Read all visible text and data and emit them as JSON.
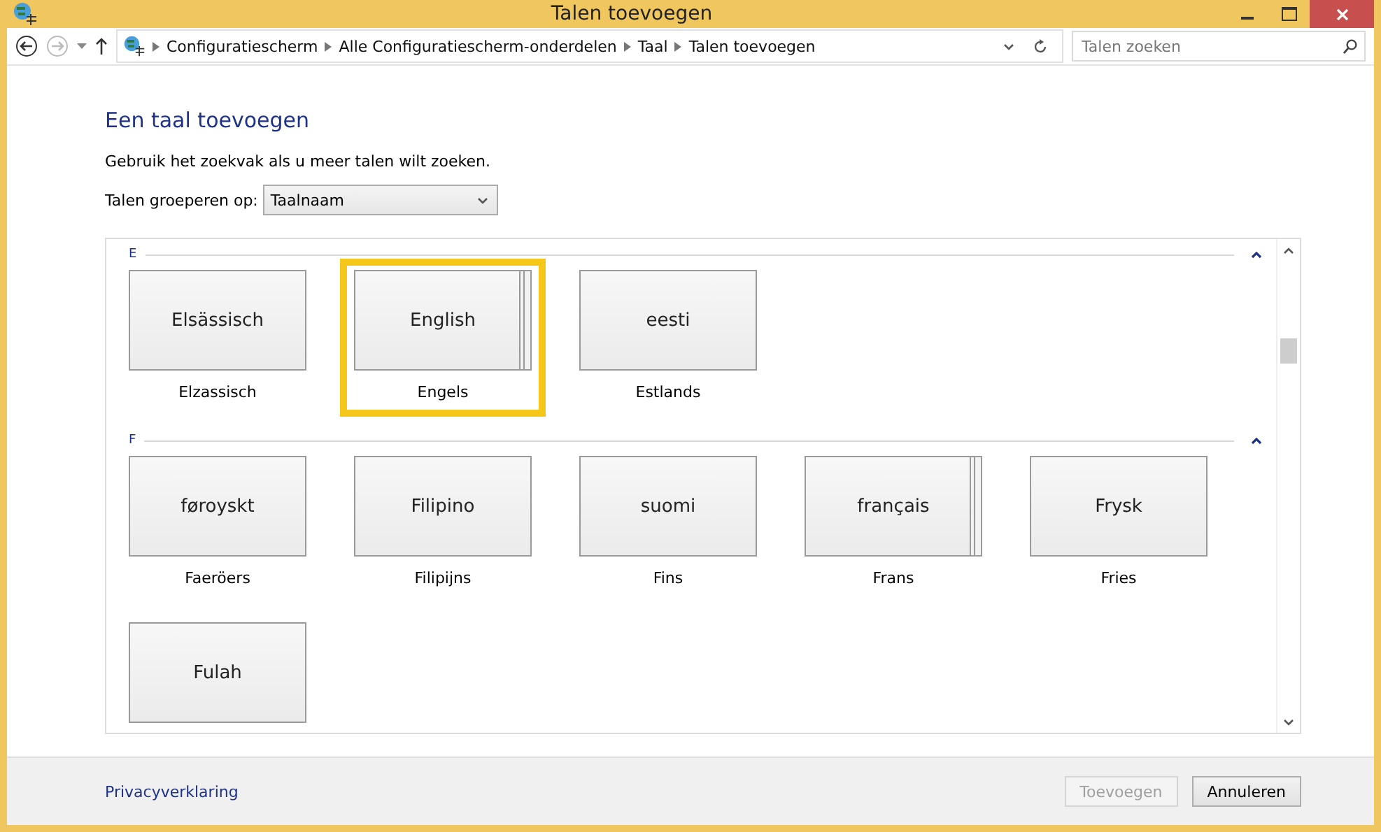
{
  "window": {
    "title": "Talen toevoegen"
  },
  "address_bar": {
    "path": [
      "Configuratiescherm",
      "Alle Configuratiescherm-onderdelen",
      "Taal",
      "Talen toevoegen"
    ]
  },
  "search": {
    "placeholder": "Talen zoeken"
  },
  "heading": "Een taal toevoegen",
  "hint": "Gebruik het zoekvak als u meer talen wilt zoeken.",
  "group_by": {
    "label": "Talen groeperen op:",
    "value": "Taalnaam"
  },
  "groups": [
    {
      "letter": "E",
      "items": [
        {
          "native": "Elsässisch",
          "name": "Elzassisch",
          "selected": false,
          "stacked": false
        },
        {
          "native": "English",
          "name": "Engels",
          "selected": true,
          "stacked": true
        },
        {
          "native": "eesti",
          "name": "Estlands",
          "selected": false,
          "stacked": false
        }
      ]
    },
    {
      "letter": "F",
      "items": [
        {
          "native": "føroyskt",
          "name": "Faeröers",
          "selected": false,
          "stacked": false
        },
        {
          "native": "Filipino",
          "name": "Filipijns",
          "selected": false,
          "stacked": false
        },
        {
          "native": "suomi",
          "name": "Fins",
          "selected": false,
          "stacked": false
        },
        {
          "native": "français",
          "name": "Frans",
          "selected": false,
          "stacked": true
        },
        {
          "native": "Frysk",
          "name": "Fries",
          "selected": false,
          "stacked": false
        },
        {
          "native": "Fulah",
          "selected": false,
          "stacked": false
        }
      ]
    }
  ],
  "footer": {
    "link": "Privacyverklaring",
    "buttons": [
      {
        "label": "Toevoegen",
        "disabled": true
      },
      {
        "label": "Annuleren",
        "disabled": false
      }
    ]
  }
}
